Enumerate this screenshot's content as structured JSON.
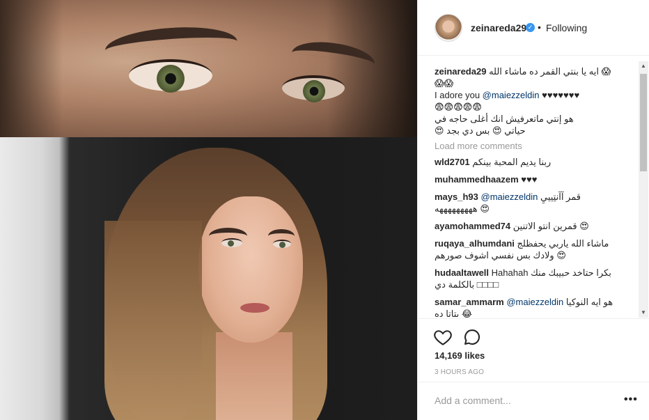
{
  "post": {
    "username": "zeinareda29",
    "verified": true,
    "follow_status": "Following",
    "separator": "•",
    "caption": {
      "username": "zeinareda29",
      "line1": "ايه يا بنتي القمر ده ماشاء الله 😱😱😱",
      "line2_text": "I adore you",
      "line2_mention": "@maiezzeldin",
      "line2_hearts": "♥♥♥♥♥♥♥",
      "line3": "😨😨😨😨😨",
      "line4": "هو إنتي ماتعرفيش انك أغلى حاجه في حياتي 😍 بس دي بجد 😍"
    },
    "load_more": "Load more comments",
    "comments": [
      {
        "user": "wld2701",
        "text": "ربنا يديم المحبة بينكم"
      },
      {
        "user": "muhammedhaazem",
        "text": "♥♥♥"
      },
      {
        "user": "mays_h93",
        "mention": "@maiezzeldin",
        "text": "قمر آآنتِيييِ هههههههههه 😍"
      },
      {
        "user": "ayamohammed74",
        "text": "قمرين انتو الاتنين 😍"
      },
      {
        "user": "ruqaya_alhumdani",
        "text": "ماشاء الله ياربي يحفظلج ولادك بس نفسي اشوف صورهم 😍"
      },
      {
        "user": "hudaaltawell",
        "text": "Hahahah",
        "text2": "بكرا حتاخد حبيبك منك بالكلمة دي □□□□"
      },
      {
        "user": "samar_ammarm",
        "mention": "@maiezzeldin",
        "text": "هو ايه النوكيا بتاتا ده 😂"
      }
    ],
    "likes": "14,169 likes",
    "time": "3 HOURS AGO",
    "add_comment_placeholder": "Add a comment...",
    "more_options": "•••"
  },
  "icons": {
    "like": "heart-outline-icon",
    "comment": "speech-bubble-icon",
    "verified": "verified-badge-icon"
  },
  "colors": {
    "mention": "#003569",
    "verified": "#3897f0",
    "muted": "#999999",
    "text": "#262626"
  }
}
